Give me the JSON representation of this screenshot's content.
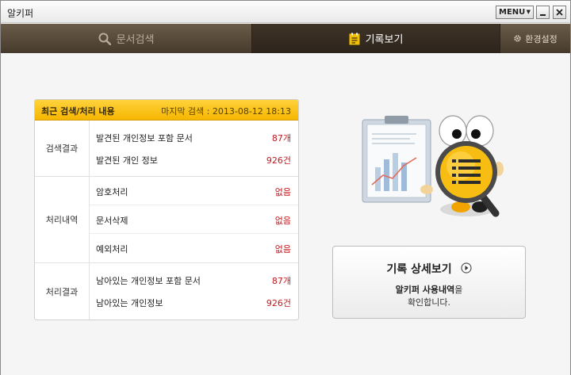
{
  "window": {
    "title": "알키퍼",
    "menu_label": "MENU"
  },
  "tabs": [
    {
      "label": "문서검색",
      "active": false
    },
    {
      "label": "기록보기",
      "active": true
    },
    {
      "label": "환경설정",
      "active": false
    }
  ],
  "summary": {
    "title": "최근 검색/처리 내용",
    "last_search": "마지막 검색 : 2013-08-12 18:13",
    "groups": [
      {
        "label": "검색결과",
        "rows": [
          {
            "label": "발견된 개인정보 포함 문서",
            "value": "87개"
          },
          {
            "label": "발견된 개인 정보",
            "value": "926건"
          }
        ]
      },
      {
        "label": "처리내역",
        "rows": [
          {
            "label": "암호처리",
            "value": "없음"
          },
          {
            "label": "문서삭제",
            "value": "없음"
          },
          {
            "label": "예외처리",
            "value": "없음"
          }
        ]
      },
      {
        "label": "처리결과",
        "rows": [
          {
            "label": "남아있는 개인정보 포함 문서",
            "value": "87개"
          },
          {
            "label": "남아있는 개인정보",
            "value": "926건"
          }
        ]
      }
    ]
  },
  "detail_button": {
    "title": "기록 상세보기",
    "desc_bold": "알키퍼 사용내역",
    "desc_rest": "을",
    "desc_line2": "확인합니다."
  },
  "colors": {
    "accent_yellow": "#f6b600",
    "tab_bar": "#463a2c",
    "value_red": "#c4161c"
  },
  "icons": {
    "tab_search": "magnifier-icon",
    "tab_history": "notepad-icon",
    "tab_settings": "gear-icon",
    "detail_arrow": "play-circle-icon",
    "illustration": "mascot-magnifier-report"
  }
}
